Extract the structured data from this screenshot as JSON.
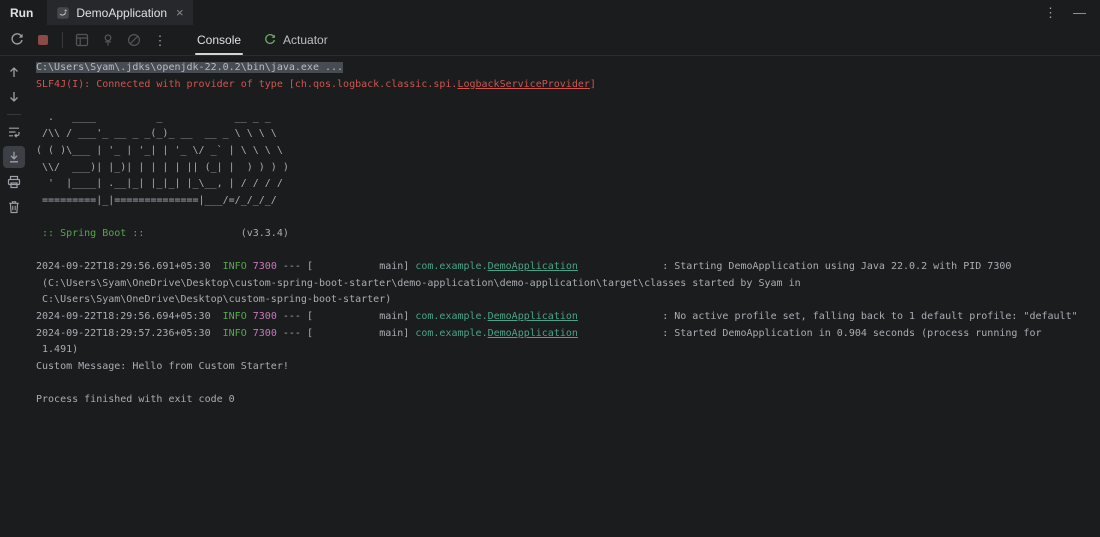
{
  "window": {
    "title": "Run",
    "tab": {
      "label": "DemoApplication",
      "close_glyph": "×"
    },
    "controls": {
      "more_glyph": "⋮",
      "hide_glyph": "—"
    }
  },
  "toolbar": {
    "buttons": [
      "rerun",
      "stop",
      "restore-layout",
      "pin-tab",
      "clear-all",
      "more-actions"
    ],
    "more_glyph": "⋮",
    "tabs": [
      {
        "label": "Console",
        "active": true
      },
      {
        "label": "Actuator",
        "active": false
      }
    ]
  },
  "left_toolbar": {
    "buttons": [
      "up-the-stack-trace",
      "down-the-stack-trace",
      "soft-wrap",
      "scroll-to-end",
      "print",
      "clear-all"
    ]
  },
  "colors": {
    "background": "#1a1c1e",
    "info_green": "#57a64a",
    "pid_magenta": "#c878bc",
    "logger_teal": "#4aa386",
    "error_red": "#cf564f",
    "selection": "#474c52",
    "spring_green": "#6aab5c"
  },
  "console": {
    "lines": [
      {
        "s": [
          [
            "sel",
            "C:\\Users\\Syam\\.jdks\\openjdk-22.0.2\\bin\\java.exe ..."
          ]
        ]
      },
      {
        "s": [
          [
            "err",
            "SLF4J(I): Connected with provider of type [ch.qos.logback.classic.spi."
          ],
          [
            "errlink",
            "LogbackServiceProvider"
          ],
          [
            "err",
            "]"
          ]
        ]
      },
      {
        "s": []
      },
      {
        "s": [
          [
            "def",
            "  .   ____          _            __ _ _"
          ]
        ]
      },
      {
        "s": [
          [
            "def",
            " /\\\\ / ___'_ __ _ _(_)_ __  __ _ \\ \\ \\ \\"
          ]
        ]
      },
      {
        "s": [
          [
            "def",
            "( ( )\\___ | '_ | '_| | '_ \\/ _` | \\ \\ \\ \\"
          ]
        ]
      },
      {
        "s": [
          [
            "def",
            " \\\\/  ___)| |_)| | | | | || (_| |  ) ) ) )"
          ]
        ]
      },
      {
        "s": [
          [
            "def",
            "  '  |____| .__|_| |_|_| |_\\__, | / / / /"
          ]
        ]
      },
      {
        "s": [
          [
            "def",
            " =========|_|==============|___/=/_/_/_/"
          ]
        ]
      },
      {
        "s": []
      },
      {
        "s": [
          [
            "spring",
            " :: Spring Boot ::"
          ],
          [
            "def",
            "                (v3.3.4)"
          ]
        ]
      },
      {
        "s": []
      },
      {
        "s": [
          [
            "def",
            "2024-09-22T18:29:56.691+05:30  "
          ],
          [
            "info",
            "INFO"
          ],
          [
            "def",
            " "
          ],
          [
            "pid",
            "7300"
          ],
          [
            "def",
            " --- [           main] "
          ],
          [
            "pkg",
            "com.example."
          ],
          [
            "pkglink",
            "DemoApplication"
          ],
          [
            "def",
            "              : Starting DemoApplication using Java 22.0.2 with PID 7300"
          ]
        ]
      },
      {
        "s": [
          [
            "def",
            " (C:\\Users\\Syam\\OneDrive\\Desktop\\custom-spring-boot-starter\\demo-application\\demo-application\\target\\classes started by Syam in"
          ]
        ]
      },
      {
        "s": [
          [
            "def",
            " C:\\Users\\Syam\\OneDrive\\Desktop\\custom-spring-boot-starter)"
          ]
        ]
      },
      {
        "s": [
          [
            "def",
            "2024-09-22T18:29:56.694+05:30  "
          ],
          [
            "info",
            "INFO"
          ],
          [
            "def",
            " "
          ],
          [
            "pid",
            "7300"
          ],
          [
            "def",
            " --- [           main] "
          ],
          [
            "pkg",
            "com.example."
          ],
          [
            "pkglink",
            "DemoApplication"
          ],
          [
            "def",
            "              : No active profile set, falling back to 1 default profile: \"default\""
          ]
        ]
      },
      {
        "s": [
          [
            "def",
            "2024-09-22T18:29:57.236+05:30  "
          ],
          [
            "info",
            "INFO"
          ],
          [
            "def",
            " "
          ],
          [
            "pid",
            "7300"
          ],
          [
            "def",
            " --- [           main] "
          ],
          [
            "pkg",
            "com.example."
          ],
          [
            "pkglink",
            "DemoApplication"
          ],
          [
            "def",
            "              : Started DemoApplication in 0.904 seconds (process running for"
          ]
        ]
      },
      {
        "s": [
          [
            "def",
            " 1.491)"
          ]
        ]
      },
      {
        "s": [
          [
            "def",
            "Custom Message: Hello from Custom Starter!"
          ]
        ]
      },
      {
        "s": []
      },
      {
        "s": [
          [
            "def",
            "Process finished with exit code 0"
          ]
        ]
      }
    ]
  }
}
